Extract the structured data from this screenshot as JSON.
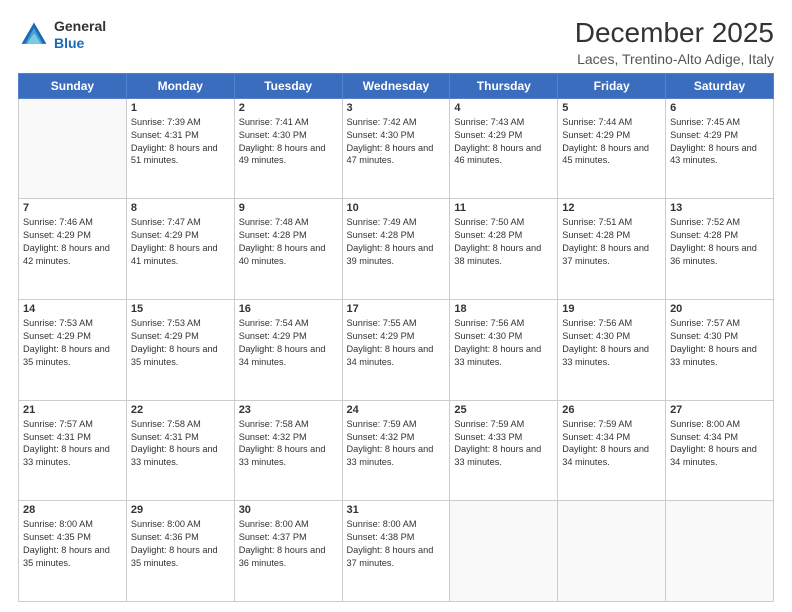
{
  "logo": {
    "general": "General",
    "blue": "Blue"
  },
  "title": "December 2025",
  "location": "Laces, Trentino-Alto Adige, Italy",
  "days_of_week": [
    "Sunday",
    "Monday",
    "Tuesday",
    "Wednesday",
    "Thursday",
    "Friday",
    "Saturday"
  ],
  "weeks": [
    [
      {
        "day": "",
        "sunrise": "",
        "sunset": "",
        "daylight": ""
      },
      {
        "day": "1",
        "sunrise": "Sunrise: 7:39 AM",
        "sunset": "Sunset: 4:31 PM",
        "daylight": "Daylight: 8 hours and 51 minutes."
      },
      {
        "day": "2",
        "sunrise": "Sunrise: 7:41 AM",
        "sunset": "Sunset: 4:30 PM",
        "daylight": "Daylight: 8 hours and 49 minutes."
      },
      {
        "day": "3",
        "sunrise": "Sunrise: 7:42 AM",
        "sunset": "Sunset: 4:30 PM",
        "daylight": "Daylight: 8 hours and 47 minutes."
      },
      {
        "day": "4",
        "sunrise": "Sunrise: 7:43 AM",
        "sunset": "Sunset: 4:29 PM",
        "daylight": "Daylight: 8 hours and 46 minutes."
      },
      {
        "day": "5",
        "sunrise": "Sunrise: 7:44 AM",
        "sunset": "Sunset: 4:29 PM",
        "daylight": "Daylight: 8 hours and 45 minutes."
      },
      {
        "day": "6",
        "sunrise": "Sunrise: 7:45 AM",
        "sunset": "Sunset: 4:29 PM",
        "daylight": "Daylight: 8 hours and 43 minutes."
      }
    ],
    [
      {
        "day": "7",
        "sunrise": "Sunrise: 7:46 AM",
        "sunset": "Sunset: 4:29 PM",
        "daylight": "Daylight: 8 hours and 42 minutes."
      },
      {
        "day": "8",
        "sunrise": "Sunrise: 7:47 AM",
        "sunset": "Sunset: 4:29 PM",
        "daylight": "Daylight: 8 hours and 41 minutes."
      },
      {
        "day": "9",
        "sunrise": "Sunrise: 7:48 AM",
        "sunset": "Sunset: 4:28 PM",
        "daylight": "Daylight: 8 hours and 40 minutes."
      },
      {
        "day": "10",
        "sunrise": "Sunrise: 7:49 AM",
        "sunset": "Sunset: 4:28 PM",
        "daylight": "Daylight: 8 hours and 39 minutes."
      },
      {
        "day": "11",
        "sunrise": "Sunrise: 7:50 AM",
        "sunset": "Sunset: 4:28 PM",
        "daylight": "Daylight: 8 hours and 38 minutes."
      },
      {
        "day": "12",
        "sunrise": "Sunrise: 7:51 AM",
        "sunset": "Sunset: 4:28 PM",
        "daylight": "Daylight: 8 hours and 37 minutes."
      },
      {
        "day": "13",
        "sunrise": "Sunrise: 7:52 AM",
        "sunset": "Sunset: 4:28 PM",
        "daylight": "Daylight: 8 hours and 36 minutes."
      }
    ],
    [
      {
        "day": "14",
        "sunrise": "Sunrise: 7:53 AM",
        "sunset": "Sunset: 4:29 PM",
        "daylight": "Daylight: 8 hours and 35 minutes."
      },
      {
        "day": "15",
        "sunrise": "Sunrise: 7:53 AM",
        "sunset": "Sunset: 4:29 PM",
        "daylight": "Daylight: 8 hours and 35 minutes."
      },
      {
        "day": "16",
        "sunrise": "Sunrise: 7:54 AM",
        "sunset": "Sunset: 4:29 PM",
        "daylight": "Daylight: 8 hours and 34 minutes."
      },
      {
        "day": "17",
        "sunrise": "Sunrise: 7:55 AM",
        "sunset": "Sunset: 4:29 PM",
        "daylight": "Daylight: 8 hours and 34 minutes."
      },
      {
        "day": "18",
        "sunrise": "Sunrise: 7:56 AM",
        "sunset": "Sunset: 4:30 PM",
        "daylight": "Daylight: 8 hours and 33 minutes."
      },
      {
        "day": "19",
        "sunrise": "Sunrise: 7:56 AM",
        "sunset": "Sunset: 4:30 PM",
        "daylight": "Daylight: 8 hours and 33 minutes."
      },
      {
        "day": "20",
        "sunrise": "Sunrise: 7:57 AM",
        "sunset": "Sunset: 4:30 PM",
        "daylight": "Daylight: 8 hours and 33 minutes."
      }
    ],
    [
      {
        "day": "21",
        "sunrise": "Sunrise: 7:57 AM",
        "sunset": "Sunset: 4:31 PM",
        "daylight": "Daylight: 8 hours and 33 minutes."
      },
      {
        "day": "22",
        "sunrise": "Sunrise: 7:58 AM",
        "sunset": "Sunset: 4:31 PM",
        "daylight": "Daylight: 8 hours and 33 minutes."
      },
      {
        "day": "23",
        "sunrise": "Sunrise: 7:58 AM",
        "sunset": "Sunset: 4:32 PM",
        "daylight": "Daylight: 8 hours and 33 minutes."
      },
      {
        "day": "24",
        "sunrise": "Sunrise: 7:59 AM",
        "sunset": "Sunset: 4:32 PM",
        "daylight": "Daylight: 8 hours and 33 minutes."
      },
      {
        "day": "25",
        "sunrise": "Sunrise: 7:59 AM",
        "sunset": "Sunset: 4:33 PM",
        "daylight": "Daylight: 8 hours and 33 minutes."
      },
      {
        "day": "26",
        "sunrise": "Sunrise: 7:59 AM",
        "sunset": "Sunset: 4:34 PM",
        "daylight": "Daylight: 8 hours and 34 minutes."
      },
      {
        "day": "27",
        "sunrise": "Sunrise: 8:00 AM",
        "sunset": "Sunset: 4:34 PM",
        "daylight": "Daylight: 8 hours and 34 minutes."
      }
    ],
    [
      {
        "day": "28",
        "sunrise": "Sunrise: 8:00 AM",
        "sunset": "Sunset: 4:35 PM",
        "daylight": "Daylight: 8 hours and 35 minutes."
      },
      {
        "day": "29",
        "sunrise": "Sunrise: 8:00 AM",
        "sunset": "Sunset: 4:36 PM",
        "daylight": "Daylight: 8 hours and 35 minutes."
      },
      {
        "day": "30",
        "sunrise": "Sunrise: 8:00 AM",
        "sunset": "Sunset: 4:37 PM",
        "daylight": "Daylight: 8 hours and 36 minutes."
      },
      {
        "day": "31",
        "sunrise": "Sunrise: 8:00 AM",
        "sunset": "Sunset: 4:38 PM",
        "daylight": "Daylight: 8 hours and 37 minutes."
      },
      {
        "day": "",
        "sunrise": "",
        "sunset": "",
        "daylight": ""
      },
      {
        "day": "",
        "sunrise": "",
        "sunset": "",
        "daylight": ""
      },
      {
        "day": "",
        "sunrise": "",
        "sunset": "",
        "daylight": ""
      }
    ]
  ]
}
